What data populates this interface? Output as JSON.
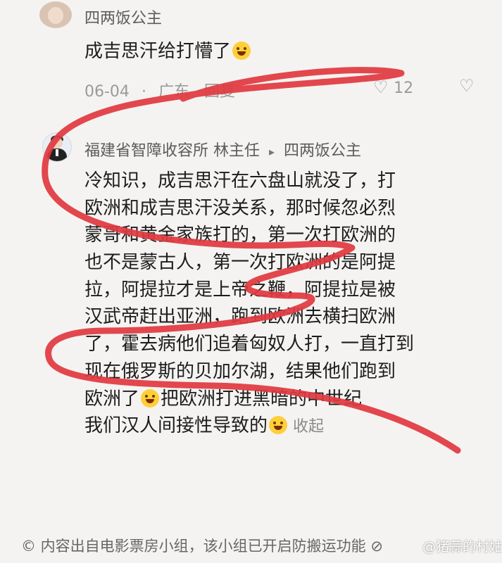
{
  "original_comment": {
    "username": "四两饭公主",
    "text": "成吉思汗给打懵了",
    "emoji_icon": "laughing-crying-emoji",
    "date": "06-04",
    "dot": "·",
    "location": "广东",
    "reply_label": "回复",
    "like_count": "12"
  },
  "reply_comment": {
    "username": "福建省智障收容所 林主任",
    "arrow": "▸",
    "reply_to": "四两饭公主",
    "lines": [
      "冷知识，成吉思汗在六盘山就没了，打",
      "欧洲和成吉思汗没关系，那时候忽必烈",
      "蒙哥和黄金家族打的，第一次打欧洲的",
      "也不是蒙古人，第一次打欧洲的是阿提",
      "拉，阿提拉才是上帝之鞭，阿提拉是被",
      "汉武帝赶出亚洲，跑到欧洲去横扫欧洲",
      "了，霍去病他们追着匈奴人打，一直打到",
      "现在俄罗斯的贝加尔湖，结果他们跑到"
    ],
    "line9_before_emoji": "欧洲了",
    "line9_after_emoji": "把欧洲打进黑暗的中世纪",
    "line10_text": "我们汉人间接性导致的",
    "collapse_label": "收起"
  },
  "footer": {
    "source_note": "© 内容出自电影票房小组，该小组已开启防搬运功能 ⊘"
  },
  "watermark": "@猪蒜的村姑",
  "colors": {
    "scribble": "#e0383f",
    "background": "#f4f3f1",
    "meta": "#9a9a9a"
  }
}
